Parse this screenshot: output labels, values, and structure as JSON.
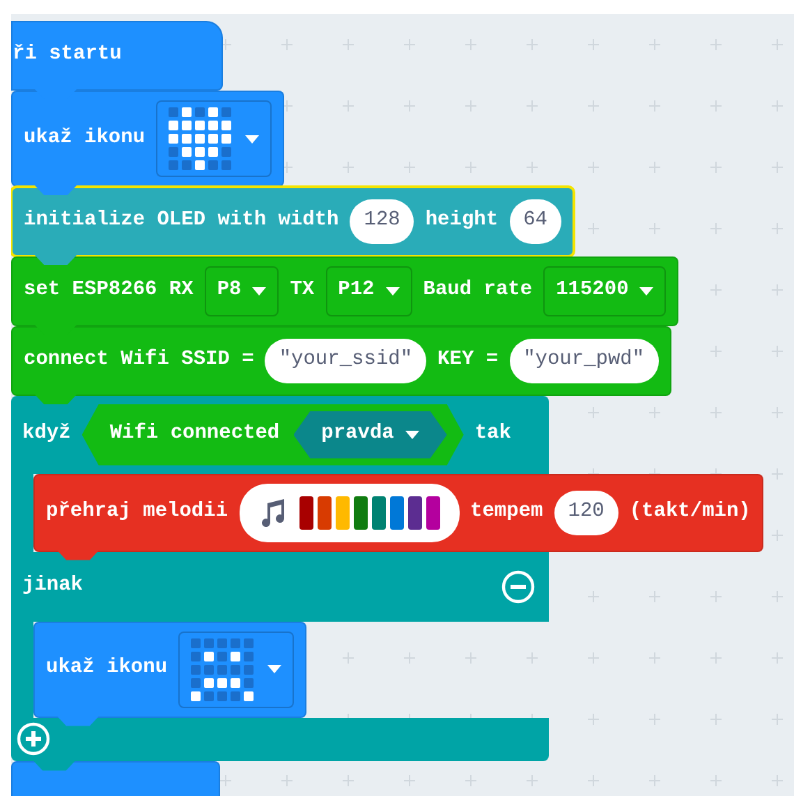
{
  "blocks": [
    {
      "kind": "hat",
      "color": "#1e90ff",
      "selected": false,
      "parts": [
        {
          "kind": "label",
          "text": "ři startu"
        }
      ]
    },
    {
      "kind": "statement",
      "color": "#1e90ff",
      "selected": false,
      "parts": [
        {
          "kind": "label",
          "text": "ukaž ikonu"
        },
        {
          "kind": "icon",
          "leds": [
            [
              false,
              true,
              false,
              true,
              false
            ],
            [
              true,
              true,
              true,
              true,
              true
            ],
            [
              true,
              true,
              true,
              true,
              true
            ],
            [
              false,
              true,
              true,
              true,
              false
            ],
            [
              false,
              false,
              true,
              false,
              false
            ]
          ]
        }
      ]
    },
    {
      "kind": "statement",
      "color": "#2aacb8",
      "selected": true,
      "parts": [
        {
          "kind": "label",
          "text": "initialize OLED with width"
        },
        {
          "kind": "number",
          "text": "128"
        },
        {
          "kind": "label",
          "text": "height"
        },
        {
          "kind": "number",
          "text": "64"
        }
      ]
    },
    {
      "kind": "statement",
      "color": "#13bb13",
      "selected": false,
      "parts": [
        {
          "kind": "label",
          "text": "set ESP8266 RX"
        },
        {
          "kind": "dropdown",
          "text": "P8"
        },
        {
          "kind": "label",
          "text": "TX"
        },
        {
          "kind": "dropdown",
          "text": "P12"
        },
        {
          "kind": "label",
          "text": "Baud rate"
        },
        {
          "kind": "dropdown",
          "text": "115200"
        }
      ]
    },
    {
      "kind": "statement",
      "color": "#13bb13",
      "selected": false,
      "parts": [
        {
          "kind": "label",
          "text": "connect Wifi SSID ="
        },
        {
          "kind": "string",
          "text": "\"your_ssid\""
        },
        {
          "kind": "label",
          "text": "KEY ="
        },
        {
          "kind": "string",
          "text": "\"your_pwd\""
        }
      ]
    },
    {
      "kind": "if",
      "color": "#00a4a6",
      "selected": false,
      "head": "když",
      "condition": {
        "color": "#13bb13",
        "label": "Wifi connected",
        "value": "pravda"
      },
      "then_label": "tak",
      "then": [
        {
          "kind": "statement",
          "color": "#e63022",
          "selected": false,
          "parts": [
            {
              "kind": "label",
              "text": "přehraj melodii"
            },
            {
              "kind": "melody",
              "notes": [
                {
                  "color": "#a80000"
                },
                {
                  "color": "#d83b01"
                },
                {
                  "color": "#ffb900"
                },
                {
                  "color": "#107c10"
                },
                {
                  "color": "#008272"
                },
                {
                  "color": "#0078d7"
                },
                {
                  "color": "#5c2d91"
                },
                {
                  "color": "#b4009e"
                }
              ]
            },
            {
              "kind": "label",
              "text": "tempem"
            },
            {
              "kind": "number",
              "text": "120"
            },
            {
              "kind": "label",
              "text": "(takt/min)"
            }
          ]
        }
      ],
      "else_label": "jinak",
      "else": [
        {
          "kind": "statement",
          "color": "#1e90ff",
          "selected": false,
          "parts": [
            {
              "kind": "label",
              "text": "ukaž ikonu"
            },
            {
              "kind": "icon",
              "leds": [
                [
                  false,
                  false,
                  false,
                  false,
                  false
                ],
                [
                  false,
                  true,
                  false,
                  true,
                  false
                ],
                [
                  false,
                  false,
                  false,
                  false,
                  false
                ],
                [
                  false,
                  true,
                  true,
                  true,
                  false
                ],
                [
                  true,
                  false,
                  false,
                  false,
                  true
                ]
              ]
            }
          ]
        }
      ]
    },
    {
      "kind": "stub",
      "color": "#1e90ff",
      "selected": false
    }
  ]
}
